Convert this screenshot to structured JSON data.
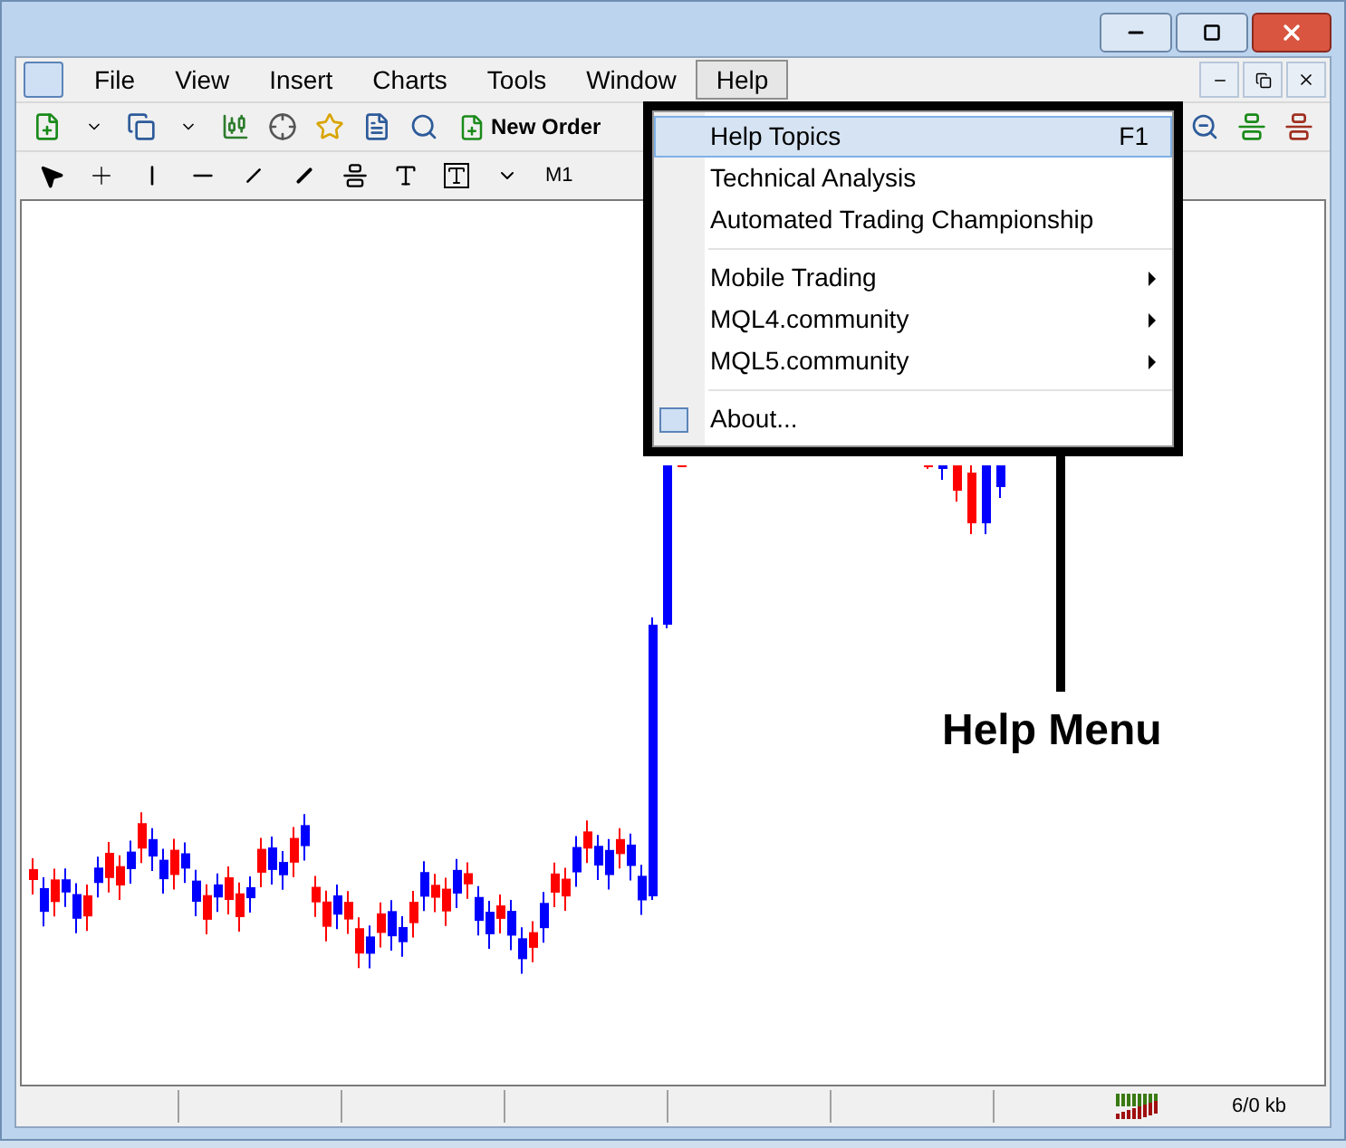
{
  "menu_bar": [
    {
      "label": "File",
      "selected": false
    },
    {
      "label": "View",
      "selected": false
    },
    {
      "label": "Insert",
      "selected": false
    },
    {
      "label": "Charts",
      "selected": false
    },
    {
      "label": "Tools",
      "selected": false
    },
    {
      "label": "Window",
      "selected": false
    },
    {
      "label": "Help",
      "selected": true
    }
  ],
  "toolbar": {
    "new_order": "New Order",
    "timeframe": "M1"
  },
  "help_menu": {
    "groups": [
      [
        {
          "label": "Help Topics",
          "shortcut": "F1",
          "kind": "item",
          "selected": true
        },
        {
          "label": "Technical Analysis",
          "kind": "item",
          "selected": false
        },
        {
          "label": "Automated Trading Championship",
          "kind": "item",
          "selected": false
        }
      ],
      [
        {
          "label": "Mobile Trading",
          "kind": "submenu",
          "selected": false
        },
        {
          "label": "MQL4.community",
          "kind": "submenu",
          "selected": false
        },
        {
          "label": "MQL5.community",
          "kind": "submenu",
          "selected": false
        }
      ],
      [
        {
          "label": "About...",
          "kind": "item",
          "selected": false,
          "icon": true
        }
      ]
    ]
  },
  "status_bar": {
    "traffic": "6/0 kb"
  },
  "annotation": {
    "label": "Help Menu"
  }
}
